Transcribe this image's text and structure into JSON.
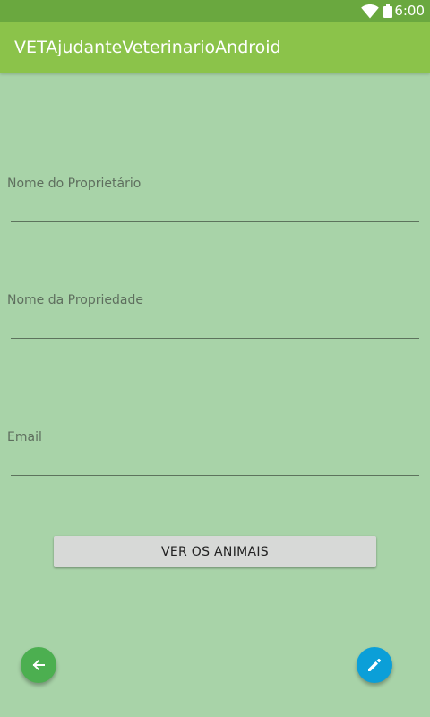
{
  "status_bar": {
    "time": "6:00",
    "icons": [
      "wifi-icon",
      "battery-icon"
    ]
  },
  "app_bar": {
    "title": "VETAjudanteVeterinarioAndroid"
  },
  "form": {
    "owner_name": {
      "label": "Nome do Proprietário",
      "value": ""
    },
    "property_name": {
      "label": "Nome da Propriedade",
      "value": ""
    },
    "email": {
      "label": "Email",
      "value": ""
    }
  },
  "buttons": {
    "view_animals": "VER OS ANIMAIS",
    "back_icon": "arrow-left-icon",
    "edit_icon": "pencil-icon"
  },
  "colors": {
    "background": "#a8d3a8",
    "status_bar": "#6aa83f",
    "app_bar": "#8bc34a",
    "button": "#d7d9d7",
    "fab_back": "#4caf50",
    "fab_edit": "#0b9fd8"
  }
}
